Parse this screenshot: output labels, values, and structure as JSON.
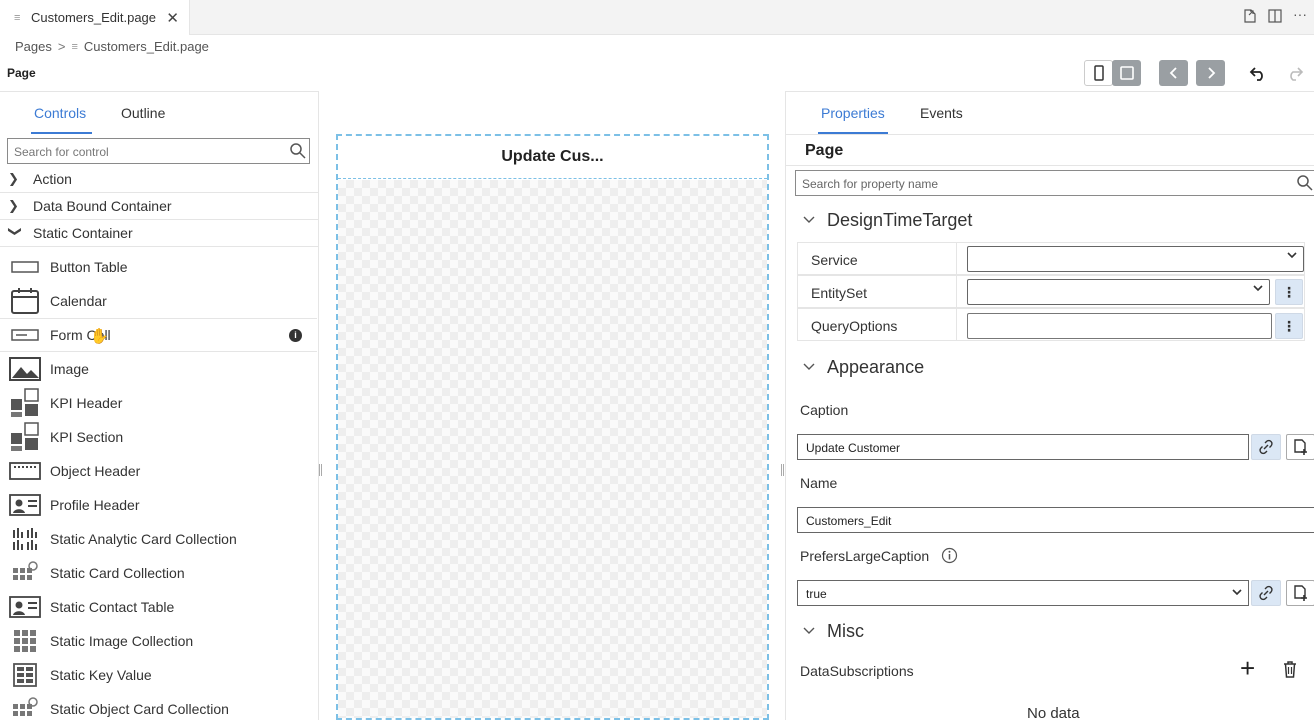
{
  "tab": {
    "title": "Customers_Edit.page",
    "close": "✕"
  },
  "breadcrumb": {
    "root": "Pages",
    "separator": ">",
    "current": "Customers_Edit.page"
  },
  "page_label": "Page",
  "left_panel": {
    "tabs": [
      "Controls",
      "Outline"
    ],
    "search_placeholder": "Search for control",
    "groups": [
      {
        "label": "Action",
        "expanded": false
      },
      {
        "label": "Data Bound Container",
        "expanded": false
      },
      {
        "label": "Static Container",
        "expanded": true
      }
    ],
    "controls": [
      "Button Table",
      "Calendar",
      "Form Cell",
      "Image",
      "KPI Header",
      "KPI Section",
      "Object Header",
      "Profile Header",
      "Static Analytic Card Collection",
      "Static Card Collection",
      "Static Contact Table",
      "Static Image Collection",
      "Static Key Value",
      "Static Object Card Collection"
    ],
    "info_badge": "i"
  },
  "canvas": {
    "header": "Update Cus..."
  },
  "right_panel": {
    "tabs": [
      "Properties",
      "Events"
    ],
    "title": "Page",
    "search_placeholder": "Search for property name",
    "sections": {
      "design_time_target": "DesignTimeTarget",
      "appearance": "Appearance",
      "misc": "Misc"
    },
    "dtt_rows": [
      "Service",
      "EntitySet",
      "QueryOptions"
    ],
    "caption_label": "Caption",
    "caption_value": "Update Customer",
    "name_label": "Name",
    "name_value": "Customers_Edit",
    "prefers_label": "PrefersLargeCaption",
    "prefers_value": "true",
    "data_subscriptions_label": "DataSubscriptions",
    "no_data": "No data",
    "more_glyph": "⋮",
    "add_glyph": "+"
  },
  "colors": {
    "accent": "#3c7bd4",
    "canvas_border": "#7cc0e6",
    "button_grey": "#9a9fa3"
  }
}
